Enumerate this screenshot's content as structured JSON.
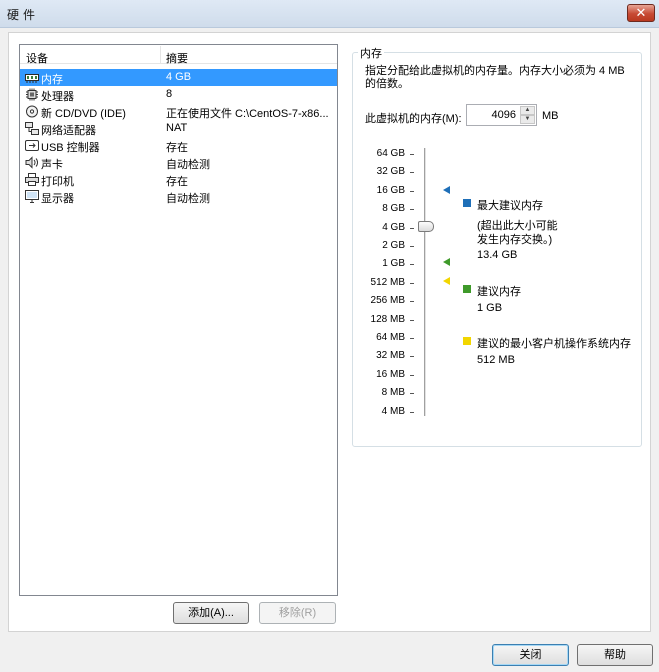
{
  "window": {
    "title": "硬件",
    "close_symbol": "✕"
  },
  "device_list": {
    "col_device": "设备",
    "col_summary": "摘要",
    "rows": [
      {
        "name": "内存",
        "summary": "4 GB",
        "icon": "memory-icon",
        "selected": true
      },
      {
        "name": "处理器",
        "summary": "8",
        "icon": "cpu-icon"
      },
      {
        "name": "新 CD/DVD (IDE)",
        "summary": "正在使用文件 C:\\CentOS-7-x86...",
        "icon": "cd-dvd-icon"
      },
      {
        "name": "网络适配器",
        "summary": "NAT",
        "icon": "network-adapter-icon"
      },
      {
        "name": "USB 控制器",
        "summary": "存在",
        "icon": "usb-icon"
      },
      {
        "name": "声卡",
        "summary": "自动检测",
        "icon": "speaker-icon"
      },
      {
        "name": "打印机",
        "summary": "存在",
        "icon": "printer-icon"
      },
      {
        "name": "显示器",
        "summary": "自动检测",
        "icon": "monitor-icon"
      }
    ]
  },
  "buttons": {
    "add": "添加(A)...",
    "remove": "移除(R)",
    "close": "关闭",
    "help": "帮助"
  },
  "memory_panel": {
    "title": "内存",
    "description": "指定分配给此虚拟机的内存量。内存大小必须为 4 MB 的倍数。",
    "field_label": "此虚拟机的内存(M):",
    "value": "4096",
    "unit": "MB",
    "scale_ticks": [
      "64 GB",
      "32 GB",
      "16 GB",
      "8 GB",
      "4 GB",
      "2 GB",
      "1 GB",
      "512 MB",
      "256 MB",
      "128 MB",
      "64 MB",
      "32 MB",
      "16 MB",
      "8 MB",
      "4 MB"
    ],
    "slider_value_mb": 4096,
    "legend": {
      "max_title": "最大建议内存",
      "max_note": "(超出此大小可能发生生内存交换。)",
      "max_note_line1": "(超出此大小可能",
      "max_note_line2": "发生内存交换。)",
      "max_value": "13.4 GB",
      "rec_title": "建议内存",
      "rec_value": "1 GB",
      "min_title": "建议的最小客户机操作系统内存",
      "min_value": "512 MB"
    },
    "colors": {
      "max": "#1e6fb8",
      "recommended": "#3f9a2a",
      "minimum": "#f2d600"
    }
  }
}
